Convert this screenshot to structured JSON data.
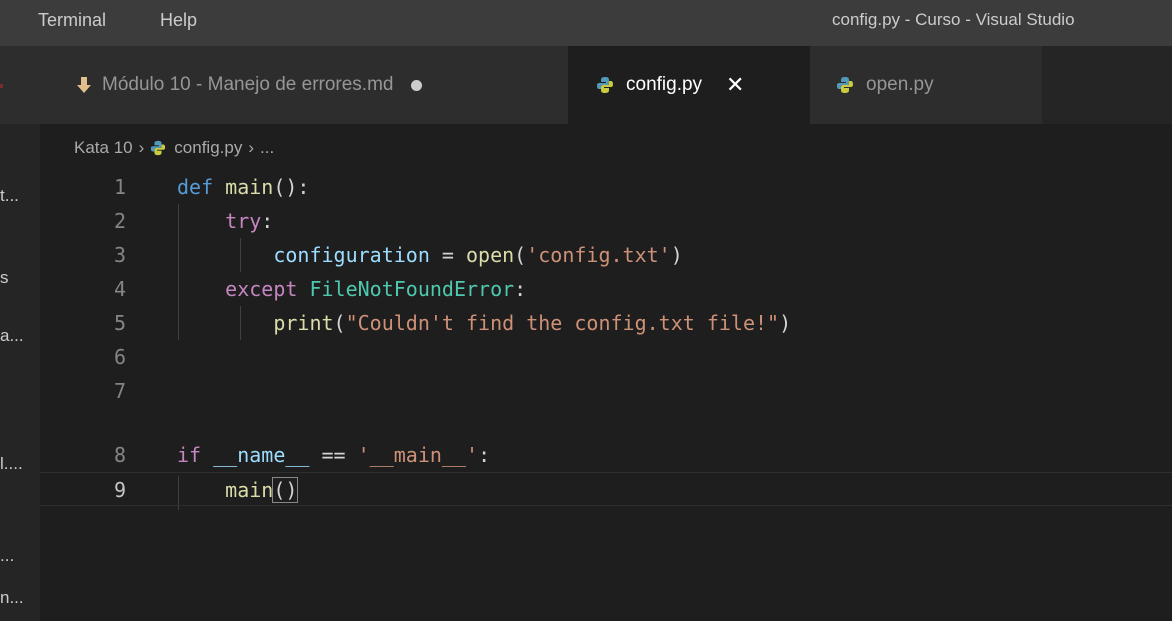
{
  "menu": {
    "items": [
      "Terminal",
      "Help"
    ]
  },
  "window": {
    "title": "config.py - Curso - Visual Studio"
  },
  "sidebar": {
    "clipped_items": [
      "t...",
      "s",
      "a...",
      "l....",
      "...",
      "n..."
    ]
  },
  "tabs": [
    {
      "label": "Módulo 10 - Manejo de errores.md",
      "icon": "markdown-icon",
      "modified": true,
      "active": false
    },
    {
      "label": "config.py",
      "icon": "python-icon",
      "close_label": "✕",
      "active": true
    },
    {
      "label": "open.py",
      "icon": "python-icon",
      "active": false
    }
  ],
  "breadcrumb": {
    "folder": "Kata 10",
    "file": "config.py",
    "more": "...",
    "separator": "›"
  },
  "editor": {
    "current_line": 9,
    "line_numbers": [
      "1",
      "2",
      "3",
      "4",
      "5",
      "6",
      "7",
      "8",
      "9"
    ],
    "code": {
      "l1": {
        "kw": "def",
        "name": "main",
        "rest": "():"
      },
      "l2": {
        "kw": "try",
        "rest": ":"
      },
      "l3": {
        "var": "configuration",
        "op": " = ",
        "fn": "open",
        "open": "(",
        "str": "'config.txt'",
        "close": ")"
      },
      "l4": {
        "kw": "except",
        "cls": "FileNotFoundError",
        "rest": ":"
      },
      "l5": {
        "fn": "print",
        "open": "(",
        "str": "\"Couldn't find the config.txt file!\"",
        "close": ")"
      },
      "l8": {
        "kw": "if",
        "var": "__name__",
        "op": " == ",
        "str": "'__main__'",
        "rest": ":"
      },
      "l9": {
        "fn": "main",
        "open": "(",
        "close": ")"
      }
    }
  },
  "colors": {
    "editor_bg": "#1e1e1e",
    "keyword_blue": "#569cd6",
    "keyword_purple": "#c586c0",
    "function": "#dcdcaa",
    "variable": "#9cdcfe",
    "string": "#ce9178",
    "class": "#4ec9b0"
  }
}
